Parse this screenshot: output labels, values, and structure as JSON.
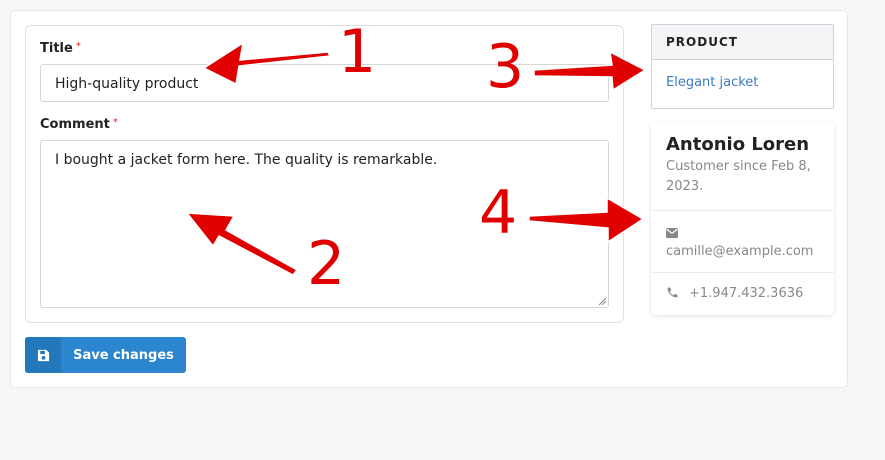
{
  "form": {
    "title_label": "Title",
    "title_required": "*",
    "title_value": "High-quality product",
    "comment_label": "Comment",
    "comment_required": "*",
    "comment_value": "I bought a jacket form here. The quality is remarkable.",
    "save_label": "Save changes",
    "save_icon": "floppy-disk-icon"
  },
  "product": {
    "header": "PRODUCT",
    "link": "Elegant jacket"
  },
  "customer": {
    "name": "Antonio Loren",
    "since": "Customer since Feb 8, 2023.",
    "email": "camille@example.com",
    "phone": "+1.947.432.3636",
    "email_icon": "envelope-icon",
    "phone_icon": "phone-icon"
  },
  "annotations": {
    "color": "#e00000",
    "labels": [
      "1",
      "2",
      "3",
      "4"
    ]
  }
}
